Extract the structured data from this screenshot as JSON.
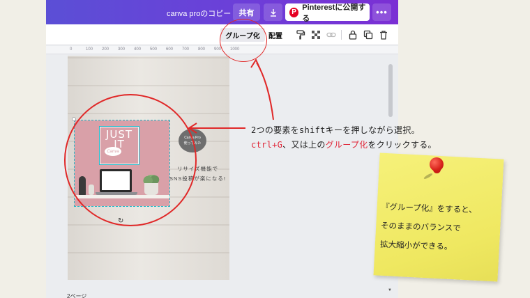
{
  "topbar": {
    "doc_title": "canva proのコピー",
    "share_label": "共有",
    "download_icon": "download-icon",
    "pinterest_label": "Pinterestに公開する",
    "pinterest_icon": "P",
    "more_icon": "•••"
  },
  "toolbar": {
    "group_label": "グループ化",
    "arrange_label": "配置",
    "icons": [
      "paint-roller-icon",
      "transparency-icon",
      "link-icon",
      "lock-icon",
      "duplicate-icon",
      "trash-icon"
    ]
  },
  "ruler": {
    "ticks": [
      "0",
      "100",
      "200",
      "300",
      "400",
      "500",
      "600",
      "700",
      "800",
      "900",
      "1000"
    ]
  },
  "design": {
    "card_title": "JUST IT",
    "canva_mark": "Canva",
    "badge_line1": "Canva Pro",
    "badge_line2": "使ってみた",
    "resize_line1": "リサイズ機能で",
    "resize_line2": "SNS投稿が楽になる!",
    "rotate_icon": "↻"
  },
  "page_label": "2ページ",
  "annotation": {
    "line1": "2つの要素をshiftキーを押しながら選択。",
    "line2_red1": "ctrl+G",
    "line2_mid": "、又は上の",
    "line2_red2": "グループ化",
    "line2_end": "をクリックする。"
  },
  "sticky_note": {
    "line1": "『グループ化』をすると、",
    "line2": "そのままのバランスで",
    "line3": "拡大縮小ができる。"
  },
  "colors": {
    "accent_purple": "#6c3fd8",
    "annotation_red": "#e02828",
    "sticky_yellow": "#f3ee6e",
    "pink_card": "#d9a0a8",
    "selection_cyan": "#1fb7c8"
  }
}
